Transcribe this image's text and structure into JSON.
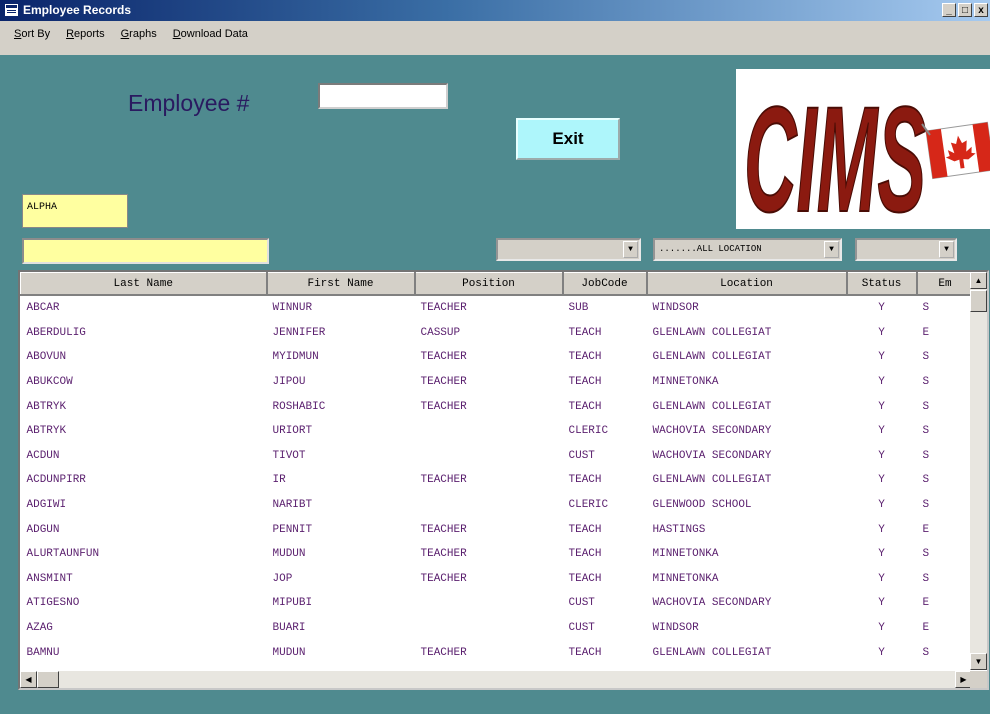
{
  "window": {
    "title": "Employee Records",
    "minimize": "_",
    "maximize": "□",
    "close": "x"
  },
  "menu": {
    "items": [
      {
        "u": "S",
        "rest": "ort By"
      },
      {
        "u": "R",
        "rest": "eports"
      },
      {
        "u": "G",
        "rest": "raphs"
      },
      {
        "u": "D",
        "rest": "ownload Data"
      }
    ]
  },
  "form": {
    "employee_label": "Employee #",
    "employee_value": "",
    "exit_label": "Exit",
    "alpha_label": "ALPHA",
    "filter_value": ""
  },
  "logo": {
    "text": "CIMS",
    "flag": "canada-flag"
  },
  "combos": [
    {
      "value": ""
    },
    {
      "value": ".......ALL LOCATION"
    },
    {
      "value": ""
    }
  ],
  "table": {
    "columns": [
      "Last Name",
      "First Name",
      "Position",
      "JobCode",
      "Location",
      "Status",
      "Em"
    ],
    "rows": [
      [
        "ABCAR",
        "WINNUR",
        "TEACHER",
        "SUB",
        "WINDSOR",
        "Y",
        "S"
      ],
      [
        "ABERDULIG",
        "JENNIFER",
        "CASSUP",
        "TEACH",
        "GLENLAWN COLLEGIAT",
        "Y",
        "E"
      ],
      [
        "ABOVUN",
        "MYIDMUN",
        "TEACHER",
        "TEACH",
        "GLENLAWN COLLEGIAT",
        "Y",
        "S"
      ],
      [
        "ABUKCOW",
        "JIPOU",
        "TEACHER",
        "TEACH",
        "MINNETONKA",
        "Y",
        "S"
      ],
      [
        "ABTRYK",
        "ROSHABIC",
        "TEACHER",
        "TEACH",
        "GLENLAWN COLLEGIAT",
        "Y",
        "S"
      ],
      [
        "ABTRYK",
        "URIORT",
        "",
        "CLERIC",
        "WACHOVIA SECONDARY",
        "Y",
        "S"
      ],
      [
        "ACDUN",
        "TIVOT",
        "",
        "CUST",
        "WACHOVIA SECONDARY",
        "Y",
        "S"
      ],
      [
        "ACDUNPIRR",
        "IR",
        "TEACHER",
        "TEACH",
        "GLENLAWN COLLEGIAT",
        "Y",
        "S"
      ],
      [
        "ADGIWI",
        "NARIBT",
        "",
        "CLERIC",
        "GLENWOOD SCHOOL",
        "Y",
        "S"
      ],
      [
        "ADGUN",
        "PENNIT",
        "TEACHER",
        "TEACH",
        "HASTINGS",
        "Y",
        "E"
      ],
      [
        "ALURTAUNFUN",
        "MUDUN",
        "TEACHER",
        "TEACH",
        "MINNETONKA",
        "Y",
        "S"
      ],
      [
        "ANSMINT",
        "JOP",
        "TEACHER",
        "TEACH",
        "MINNETONKA",
        "Y",
        "S"
      ],
      [
        "ATIGESNO",
        "MIPUBI",
        "",
        "CUST",
        "WACHOVIA SECONDARY",
        "Y",
        "E"
      ],
      [
        "AZAG",
        "BUARI",
        "",
        "CUST",
        "WINDSOR",
        "Y",
        "E"
      ],
      [
        "BAMNU",
        "MUDUN",
        "TEACHER",
        "TEACH",
        "GLENLAWN COLLEGIAT",
        "Y",
        "S"
      ]
    ]
  },
  "colors": {
    "background": "#4f8a8f",
    "exit_button": "#aef6fb",
    "highlight_field": "#ffffa0",
    "logo_text": "#8b1a10",
    "cell_text": "#5a1f6e"
  }
}
